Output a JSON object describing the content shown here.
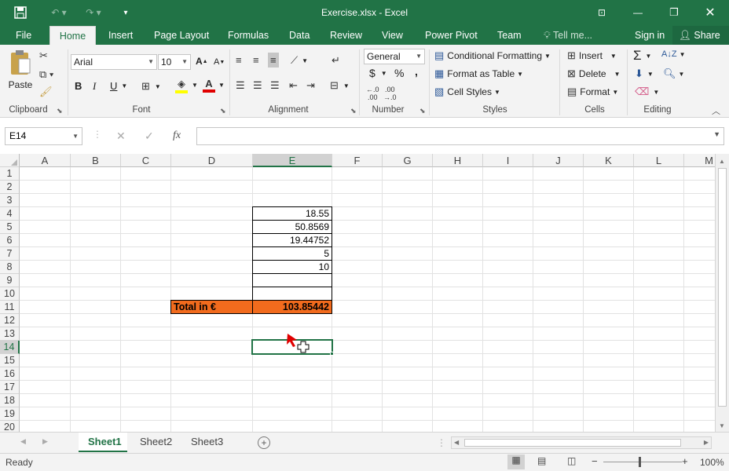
{
  "window": {
    "title": "Exercise.xlsx - Excel"
  },
  "menu": {
    "tabs": [
      "File",
      "Home",
      "Insert",
      "Page Layout",
      "Formulas",
      "Data",
      "Review",
      "View",
      "Power Pivot",
      "Team"
    ],
    "tell_me": "Tell me...",
    "sign_in": "Sign in",
    "share": "Share"
  },
  "ribbon": {
    "clipboard": {
      "paste": "Paste",
      "label": "Clipboard"
    },
    "font": {
      "name": "Arial",
      "size": "10",
      "bold": "B",
      "italic": "I",
      "underline": "U",
      "label": "Font"
    },
    "alignment": {
      "label": "Alignment"
    },
    "number": {
      "format": "General",
      "currency": "$",
      "percent": "%",
      "comma": ",",
      "label": "Number"
    },
    "styles": {
      "conditional": "Conditional Formatting",
      "format_table": "Format as Table",
      "cell_styles": "Cell Styles",
      "label": "Styles"
    },
    "cells": {
      "insert": "Insert",
      "delete": "Delete",
      "format": "Format",
      "label": "Cells"
    },
    "editing": {
      "label": "Editing"
    }
  },
  "formula_bar": {
    "name_box": "E14",
    "fx": "fx",
    "value": ""
  },
  "grid": {
    "columns": [
      "A",
      "B",
      "C",
      "D",
      "E",
      "F",
      "G",
      "H",
      "I",
      "J",
      "K",
      "L",
      "M"
    ],
    "rows": [
      "1",
      "2",
      "3",
      "4",
      "5",
      "6",
      "7",
      "8",
      "9",
      "10",
      "11",
      "12",
      "13",
      "14",
      "15",
      "16",
      "17",
      "18",
      "19",
      "20"
    ],
    "selected_column": "E",
    "selected_row": "14",
    "values": {
      "e4": "18.55",
      "e5": "50.8569",
      "e6": "19.44752",
      "e7": "5",
      "e8": "10",
      "e9": "",
      "e10": ""
    },
    "total_label": "Total in €",
    "total_value": "103.85442",
    "total_color": "#f26b1d"
  },
  "sheets": [
    "Sheet1",
    "Sheet2",
    "Sheet3"
  ],
  "active_sheet": "Sheet1",
  "status": {
    "mode": "Ready",
    "zoom": "100%"
  },
  "colors": {
    "brand": "#217346"
  }
}
